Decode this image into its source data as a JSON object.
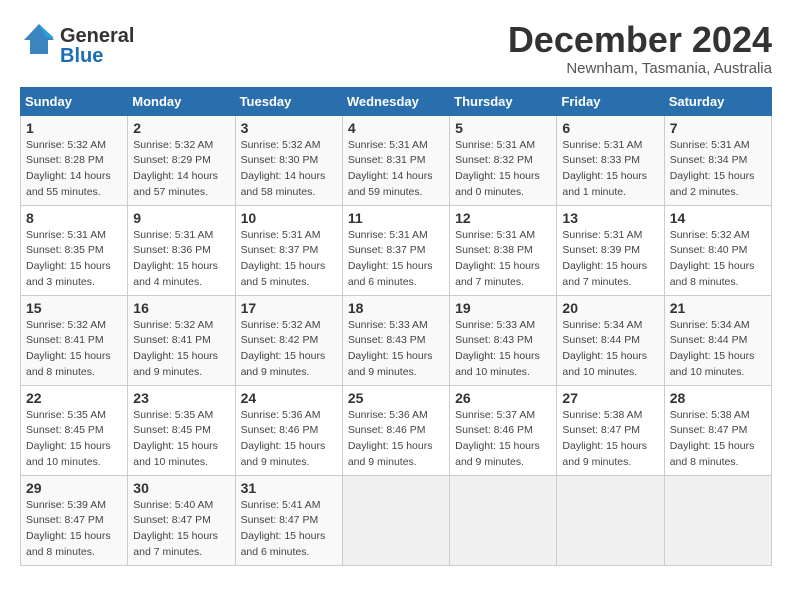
{
  "header": {
    "logo_line1": "General",
    "logo_line2": "Blue",
    "month": "December 2024",
    "location": "Newnham, Tasmania, Australia"
  },
  "days_of_week": [
    "Sunday",
    "Monday",
    "Tuesday",
    "Wednesday",
    "Thursday",
    "Friday",
    "Saturday"
  ],
  "weeks": [
    [
      {
        "day": "1",
        "info": "Sunrise: 5:32 AM\nSunset: 8:28 PM\nDaylight: 14 hours\nand 55 minutes."
      },
      {
        "day": "2",
        "info": "Sunrise: 5:32 AM\nSunset: 8:29 PM\nDaylight: 14 hours\nand 57 minutes."
      },
      {
        "day": "3",
        "info": "Sunrise: 5:32 AM\nSunset: 8:30 PM\nDaylight: 14 hours\nand 58 minutes."
      },
      {
        "day": "4",
        "info": "Sunrise: 5:31 AM\nSunset: 8:31 PM\nDaylight: 14 hours\nand 59 minutes."
      },
      {
        "day": "5",
        "info": "Sunrise: 5:31 AM\nSunset: 8:32 PM\nDaylight: 15 hours\nand 0 minutes."
      },
      {
        "day": "6",
        "info": "Sunrise: 5:31 AM\nSunset: 8:33 PM\nDaylight: 15 hours\nand 1 minute."
      },
      {
        "day": "7",
        "info": "Sunrise: 5:31 AM\nSunset: 8:34 PM\nDaylight: 15 hours\nand 2 minutes."
      }
    ],
    [
      {
        "day": "8",
        "info": "Sunrise: 5:31 AM\nSunset: 8:35 PM\nDaylight: 15 hours\nand 3 minutes."
      },
      {
        "day": "9",
        "info": "Sunrise: 5:31 AM\nSunset: 8:36 PM\nDaylight: 15 hours\nand 4 minutes."
      },
      {
        "day": "10",
        "info": "Sunrise: 5:31 AM\nSunset: 8:37 PM\nDaylight: 15 hours\nand 5 minutes."
      },
      {
        "day": "11",
        "info": "Sunrise: 5:31 AM\nSunset: 8:37 PM\nDaylight: 15 hours\nand 6 minutes."
      },
      {
        "day": "12",
        "info": "Sunrise: 5:31 AM\nSunset: 8:38 PM\nDaylight: 15 hours\nand 7 minutes."
      },
      {
        "day": "13",
        "info": "Sunrise: 5:31 AM\nSunset: 8:39 PM\nDaylight: 15 hours\nand 7 minutes."
      },
      {
        "day": "14",
        "info": "Sunrise: 5:32 AM\nSunset: 8:40 PM\nDaylight: 15 hours\nand 8 minutes."
      }
    ],
    [
      {
        "day": "15",
        "info": "Sunrise: 5:32 AM\nSunset: 8:41 PM\nDaylight: 15 hours\nand 8 minutes."
      },
      {
        "day": "16",
        "info": "Sunrise: 5:32 AM\nSunset: 8:41 PM\nDaylight: 15 hours\nand 9 minutes."
      },
      {
        "day": "17",
        "info": "Sunrise: 5:32 AM\nSunset: 8:42 PM\nDaylight: 15 hours\nand 9 minutes."
      },
      {
        "day": "18",
        "info": "Sunrise: 5:33 AM\nSunset: 8:43 PM\nDaylight: 15 hours\nand 9 minutes."
      },
      {
        "day": "19",
        "info": "Sunrise: 5:33 AM\nSunset: 8:43 PM\nDaylight: 15 hours\nand 10 minutes."
      },
      {
        "day": "20",
        "info": "Sunrise: 5:34 AM\nSunset: 8:44 PM\nDaylight: 15 hours\nand 10 minutes."
      },
      {
        "day": "21",
        "info": "Sunrise: 5:34 AM\nSunset: 8:44 PM\nDaylight: 15 hours\nand 10 minutes."
      }
    ],
    [
      {
        "day": "22",
        "info": "Sunrise: 5:35 AM\nSunset: 8:45 PM\nDaylight: 15 hours\nand 10 minutes."
      },
      {
        "day": "23",
        "info": "Sunrise: 5:35 AM\nSunset: 8:45 PM\nDaylight: 15 hours\nand 10 minutes."
      },
      {
        "day": "24",
        "info": "Sunrise: 5:36 AM\nSunset: 8:46 PM\nDaylight: 15 hours\nand 9 minutes."
      },
      {
        "day": "25",
        "info": "Sunrise: 5:36 AM\nSunset: 8:46 PM\nDaylight: 15 hours\nand 9 minutes."
      },
      {
        "day": "26",
        "info": "Sunrise: 5:37 AM\nSunset: 8:46 PM\nDaylight: 15 hours\nand 9 minutes."
      },
      {
        "day": "27",
        "info": "Sunrise: 5:38 AM\nSunset: 8:47 PM\nDaylight: 15 hours\nand 9 minutes."
      },
      {
        "day": "28",
        "info": "Sunrise: 5:38 AM\nSunset: 8:47 PM\nDaylight: 15 hours\nand 8 minutes."
      }
    ],
    [
      {
        "day": "29",
        "info": "Sunrise: 5:39 AM\nSunset: 8:47 PM\nDaylight: 15 hours\nand 8 minutes."
      },
      {
        "day": "30",
        "info": "Sunrise: 5:40 AM\nSunset: 8:47 PM\nDaylight: 15 hours\nand 7 minutes."
      },
      {
        "day": "31",
        "info": "Sunrise: 5:41 AM\nSunset: 8:47 PM\nDaylight: 15 hours\nand 6 minutes."
      },
      {
        "day": "",
        "info": ""
      },
      {
        "day": "",
        "info": ""
      },
      {
        "day": "",
        "info": ""
      },
      {
        "day": "",
        "info": ""
      }
    ]
  ]
}
